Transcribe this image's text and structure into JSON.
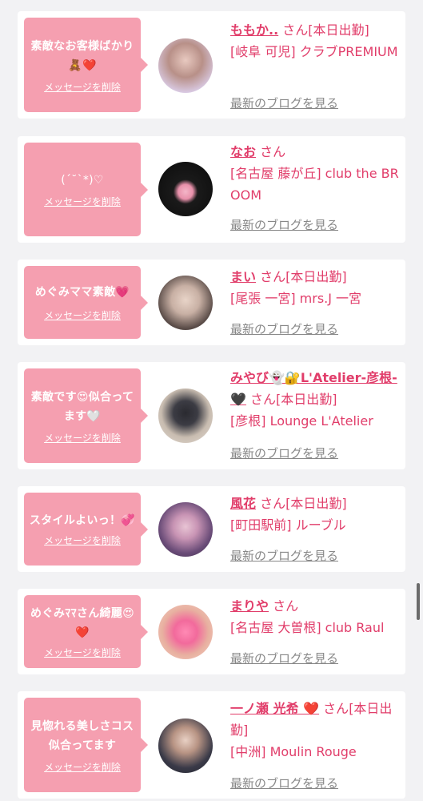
{
  "delete_label": "メッセージを削除",
  "blog_label": "最新のブログを見る",
  "san_label": "さん",
  "cards": [
    {
      "message": "素敵なお客様ばかり🧸❤️",
      "name": "ももか..",
      "badge": "[本日出勤]",
      "shop": "[岐阜 可児] クラブPREMIUM"
    },
    {
      "message": "(ˊ˘ˋ*)♡",
      "name": "なお",
      "badge": "",
      "shop": "[名古屋 藤が丘] club the BROOM"
    },
    {
      "message": "めぐみママ素敵💗",
      "name": "まい",
      "badge": "[本日出勤]",
      "shop": "[尾張 一宮] mrs.J 一宮"
    },
    {
      "message": "素敵です😍似合ってます🤍",
      "name": "みやび👻🔐L'Atelier-彦根-🖤",
      "badge": "[本日出勤]",
      "shop": "[彦根] Lounge L'Atelier"
    },
    {
      "message": "スタイルよいっ！💞",
      "name": "風花",
      "badge": "[本日出勤]",
      "shop": "[町田駅前] ルーブル"
    },
    {
      "message": "めぐみﾏﾏさん綺麗😍❤️",
      "name": "まりや",
      "badge": "",
      "shop": "[名古屋 大曽根] club Raul"
    },
    {
      "message": "見惚れる美しさコス似合ってます",
      "name": "一ノ瀬 光希 ❤️",
      "badge": "[本日出勤]",
      "shop": "[中洲] Moulin Rouge"
    }
  ],
  "colors": {
    "accent": "#e13d6a",
    "bubble": "#f59fb0",
    "background": "#f2f2f4"
  }
}
